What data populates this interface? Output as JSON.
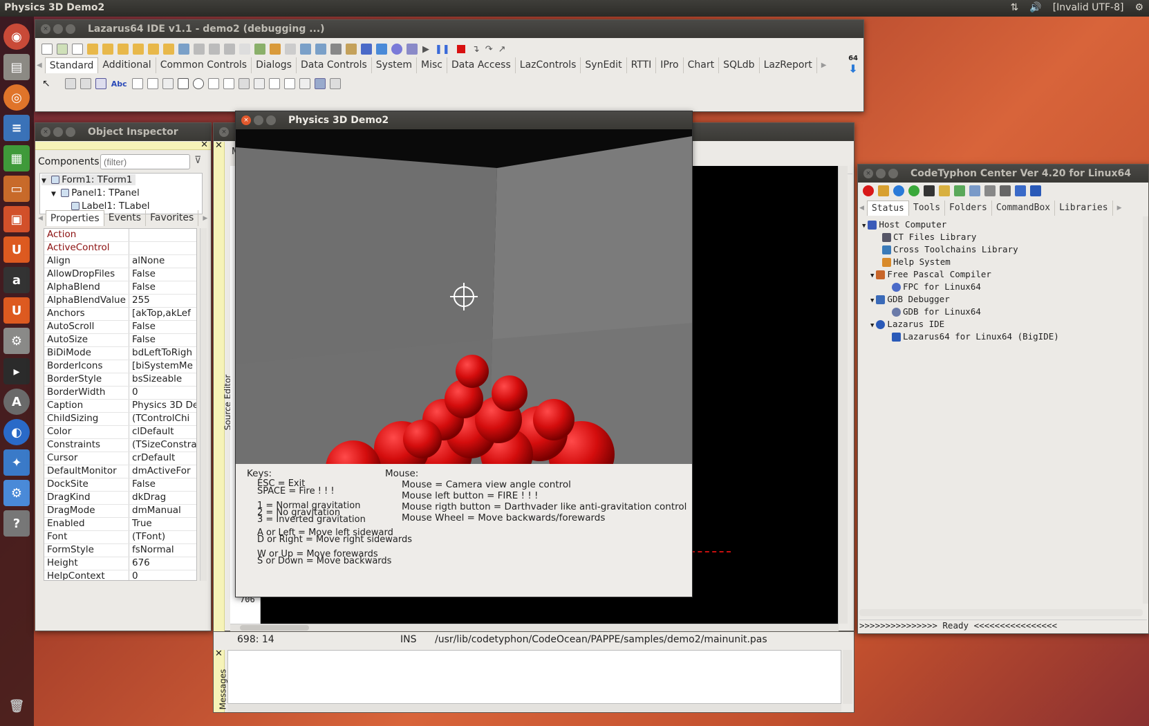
{
  "topbar": {
    "title": "Physics 3D Demo2",
    "encoding": "[Invalid UTF-8]"
  },
  "ide": {
    "title": "Lazarus64 IDE v1.1 - demo2 (debugging ...)",
    "tabs": [
      "Standard",
      "Additional",
      "Common Controls",
      "Dialogs",
      "Data Controls",
      "System",
      "Misc",
      "Data Access",
      "LazControls",
      "SynEdit",
      "RTTI",
      "IPro",
      "Chart",
      "SQLdb",
      "LazReport"
    ],
    "badge": "64"
  },
  "oi": {
    "title": "Object Inspector",
    "components_label": "Components",
    "filter_placeholder": "(filter)",
    "tree": [
      "Form1: TForm1",
      "Panel1: TPanel",
      "Label1: TLabel"
    ],
    "tabs": [
      "Properties",
      "Events",
      "Favorites"
    ],
    "props": [
      {
        "k": "Action",
        "v": "",
        "red": true
      },
      {
        "k": "ActiveControl",
        "v": "",
        "red": true
      },
      {
        "k": "Align",
        "v": "alNone"
      },
      {
        "k": "AllowDropFiles",
        "v": "False"
      },
      {
        "k": "AlphaBlend",
        "v": "False"
      },
      {
        "k": "AlphaBlendValue",
        "v": "255"
      },
      {
        "k": "Anchors",
        "v": "[akTop,akLef"
      },
      {
        "k": "AutoScroll",
        "v": "False"
      },
      {
        "k": "AutoSize",
        "v": "False"
      },
      {
        "k": "BiDiMode",
        "v": "bdLeftToRigh"
      },
      {
        "k": "BorderIcons",
        "v": "[biSystemMe"
      },
      {
        "k": "BorderStyle",
        "v": "bsSizeable"
      },
      {
        "k": "BorderWidth",
        "v": "0"
      },
      {
        "k": "Caption",
        "v": "Physics 3D De"
      },
      {
        "k": "ChildSizing",
        "v": "(TControlChi"
      },
      {
        "k": "Color",
        "v": "clDefault"
      },
      {
        "k": "Constraints",
        "v": "(TSizeConstra"
      },
      {
        "k": "Cursor",
        "v": "crDefault"
      },
      {
        "k": "DefaultMonitor",
        "v": "dmActiveFor"
      },
      {
        "k": "DockSite",
        "v": "False"
      },
      {
        "k": "DragKind",
        "v": "dkDrag"
      },
      {
        "k": "DragMode",
        "v": "dmManual"
      },
      {
        "k": "Enabled",
        "v": "True"
      },
      {
        "k": "Font",
        "v": "(TFont)"
      },
      {
        "k": "FormStyle",
        "v": "fsNormal"
      },
      {
        "k": "Height",
        "v": "676"
      },
      {
        "k": "HelpContext",
        "v": "0"
      }
    ]
  },
  "editor": {
    "side_label": "Source Editor",
    "line": "706",
    "status_pos": "698: 14",
    "status_mode": "INS",
    "status_file": "/usr/lib/codetyphon/CodeOcean/PAPPE/samples/demo2/mainunit.pas",
    "messages_label": "Messages",
    "tab_stub": "M"
  },
  "demo": {
    "title": "Physics 3D Demo2",
    "keys_title": "Keys:",
    "mouse_title": "Mouse:",
    "keys": [
      "ESC = Exit",
      "SPACE = Fire ! ! !",
      "1 = Normal gravitation",
      "2 = No gravitation",
      "3 = Inverted gravitation",
      "A or Left   = Move left sideward",
      "D or Right = Move right sidewards",
      "W or Up    = Move forewards",
      "S or Down = Move backwards"
    ],
    "mouse": [
      "Mouse = Camera view angle control",
      "Mouse left button = FIRE ! ! !",
      "Mouse rigth button = Darthvader like anti-gravitation control",
      "Mouse Wheel = Move   backwards/forewards"
    ]
  },
  "ct": {
    "title": "CodeTyphon Center Ver 4.20 for Linux64",
    "tabs": [
      "Status",
      "Tools",
      "Folders",
      "CommandBox",
      "Libraries"
    ],
    "tree": [
      "Host Computer",
      "CT Files Library",
      "Cross Toolchains Library",
      "Help System",
      "Free Pascal Compiler",
      "FPC for Linux64",
      "GDB Debugger",
      "GDB for Linux64",
      "Lazarus IDE",
      "Lazarus64 for Linux64 (BigIDE)"
    ],
    "status": ">>>>>>>>>>>>>>> Ready <<<<<<<<<<<<<<<<"
  }
}
